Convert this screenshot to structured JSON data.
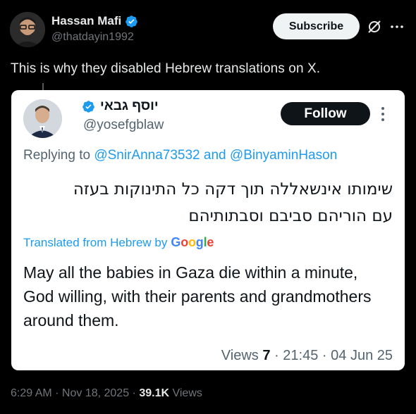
{
  "author": {
    "name": "Hassan Mafi",
    "handle": "@thatdayin1992",
    "verified_color": "#1d9bf0"
  },
  "header_actions": {
    "subscribe_label": "Subscribe",
    "grok_icon": "grok-icon",
    "more_icon": "more-horizontal-icon"
  },
  "tweet": {
    "text": "This is why they disabled Hebrew translations on X."
  },
  "quoted": {
    "name": "יוסף גבאי",
    "handle": "@yosefgblaw",
    "follow_label": "Follow",
    "replying_prefix": "Replying to",
    "mention1": "@SnirAnna73532",
    "and": "and",
    "mention2": "@BinyaminHason",
    "hebrew_line1": "שימותו אינשאללה תוך דקה כל התינוקות בעזה",
    "hebrew_line2": "עם הוריהם סביבם וסבתותיהם",
    "translated_label": "Translated from Hebrew by",
    "google_label": "Google",
    "translation": "May all the babies in Gaza die within a minute, God willing, with their parents and grandmothers around them.",
    "views_label": "Views",
    "views_count": "7",
    "sep": "·",
    "time": "21:45",
    "date": "04 Jun 25"
  },
  "footer": {
    "timestamp": "6:29 AM · Nov 18, 2025 ·",
    "views_count": "39.1K",
    "views_label": "Views"
  },
  "colors": {
    "background": "#000000",
    "accent": "#1d9bf0",
    "secondary_text": "#71767b"
  }
}
